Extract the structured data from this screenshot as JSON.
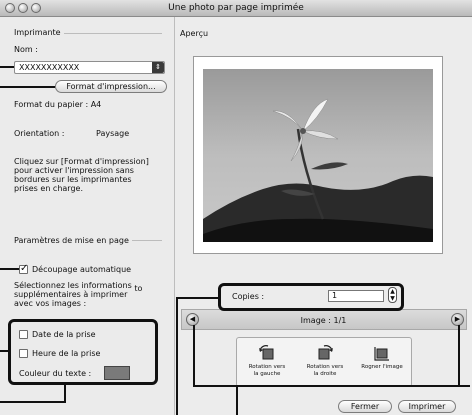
{
  "window": {
    "title": "Une photo par page imprimée"
  },
  "left": {
    "printer_group": "Imprimante",
    "name_label": "Nom :",
    "printer_value": "XXXXXXXXXXX",
    "format_button": "Format d'impression...",
    "paper_format": "Format du papier :  A4",
    "orientation_label": "Orientation :",
    "orientation_value": "Paysage",
    "info_text_lines": [
      "Cliquez sur [Format d'impression]",
      "pour activer l'impression sans",
      "bordures sur les imprimantes",
      "prises en charge."
    ],
    "layout_group": "Paramètres de mise en page",
    "auto_crop": "Découpage automatique",
    "select_info_lines": [
      "Sélectionnez les informations",
      "supplémentaires à imprimer",
      "avec vos images :"
    ],
    "select_info_suffix": "to",
    "date_label": "Date de la prise",
    "time_label": "Heure de la prise",
    "text_color_label": "Couleur du texte :",
    "text_color_value": "#7a7a7a"
  },
  "right": {
    "preview_label": "Aperçu",
    "copies_label": "Copies :",
    "copies_value": "1",
    "image_counter": "Image : 1/1",
    "tools": [
      {
        "label_lines": [
          "Rotation vers",
          "la gauche"
        ],
        "icon": "rotate-left-icon"
      },
      {
        "label_lines": [
          "Rotation vers",
          "la droite"
        ],
        "icon": "rotate-right-icon"
      },
      {
        "label_lines": [
          "Rogner l'image"
        ],
        "icon": "crop-icon"
      }
    ],
    "close_button": "Fermer",
    "print_button": "Imprimer"
  }
}
